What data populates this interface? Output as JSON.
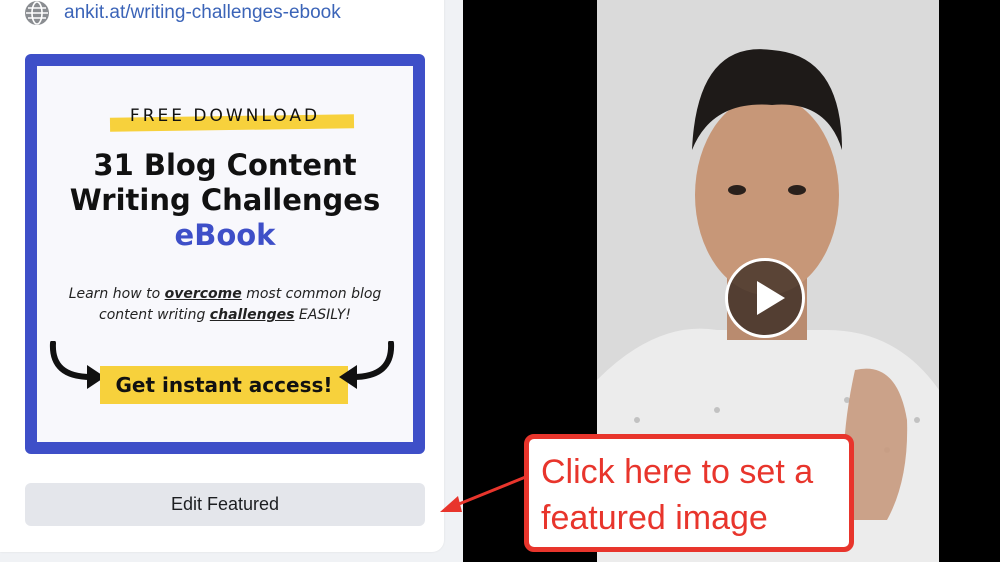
{
  "link": {
    "url": "ankit.at/writing-challenges-ebook",
    "icon": "globe-icon"
  },
  "ebook": {
    "eyebrow": "FREE DOWNLOAD",
    "title_line1": "31 Blog Content",
    "title_line2": "Writing Challenges",
    "title_line3": "eBook",
    "desc_pre": "Learn how to ",
    "desc_b1": "overcome",
    "desc_mid": " most common blog content writing ",
    "desc_b2": "challenges",
    "desc_post": " EASILY!",
    "cta": "Get instant access!"
  },
  "actions": {
    "edit_featured": "Edit Featured"
  },
  "video": {
    "play_icon": "play-icon"
  },
  "callout": {
    "text": "Click here to set a featured image"
  },
  "colors": {
    "ebook_blue": "#3e4fc8",
    "highlight": "#f7d13c",
    "callout_red": "#e8352c",
    "link": "#3b64b8"
  }
}
